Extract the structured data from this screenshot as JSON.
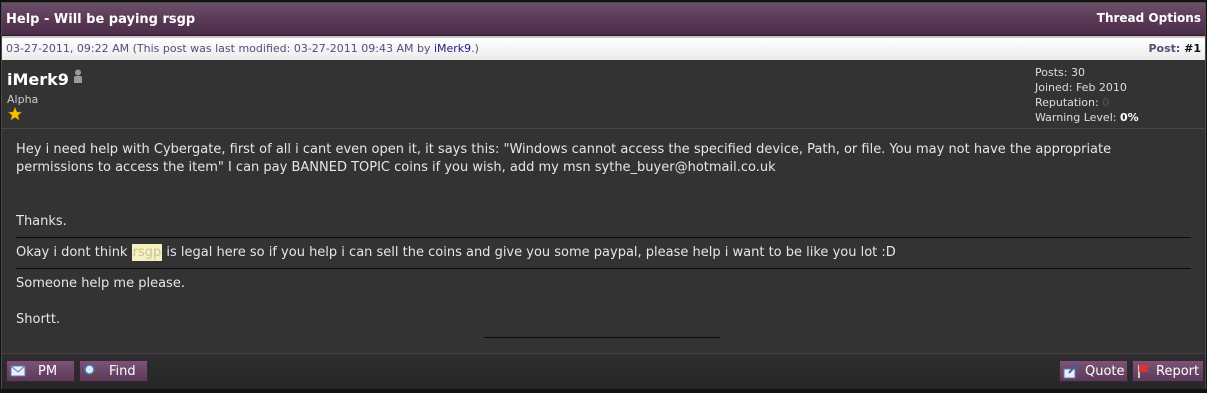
{
  "thread": {
    "title": "Help - Will be paying rsgp",
    "options_label": "Thread Options"
  },
  "post": {
    "date": "03-27-2011, 09:22 AM",
    "modified_prefix": "(This post was last modified: 03-27-2011 09:43 AM by",
    "modified_by": "iMerk9",
    "modified_suffix": ".)",
    "postno_label": "Post:",
    "postno_value": "#1"
  },
  "author": {
    "name": "iMerk9",
    "title": "Alpha",
    "posts_label": "Posts: 30",
    "joined_label": "Joined: Feb 2010",
    "reputation_label": "Reputation:",
    "reputation_value": "0",
    "warning_label": "Warning Level:",
    "warning_value": "0%"
  },
  "body": {
    "line1": "Hey i need help with Cybergate, first of all i cant even open it, it says this: \"Windows cannot access the specified device, Path, or file. You may not have the appropriate permissions to access the item\" I can pay BANNED TOPIC coins if you wish, add my msn sythe_buyer@hotmail.co.uk",
    "thanks": "Thanks.",
    "line2_pre": "Okay i dont think ",
    "line2_hl": "rsgp",
    "line2_post": " is legal here so if you help i can sell the coins and give you some paypal, please help i want to be like you lot :D",
    "line3": "Someone help me please.",
    "signoff": "Shortt."
  },
  "buttons": {
    "pm": "PM",
    "find": "Find",
    "quote": "Quote",
    "report": "Report"
  }
}
